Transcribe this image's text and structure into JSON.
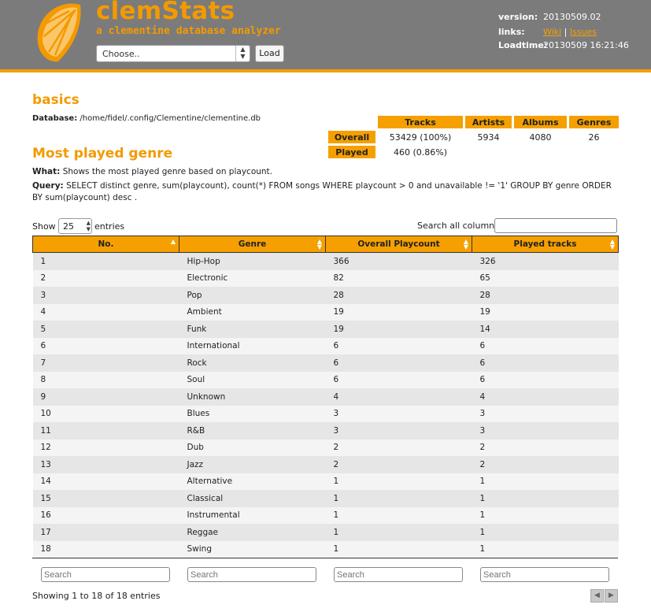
{
  "header": {
    "title": "clemStats",
    "subtitle": "a clementine database analyzer",
    "db_select_value": "Choose..",
    "load_label": "Load",
    "version_label": "version:",
    "version_value": "20130509.02",
    "links_label": "links:",
    "link_wiki": "Wiki",
    "link_sep": "|",
    "link_issues": "Issues",
    "loadtime_label": "Loadtime:",
    "loadtime_value": "20130509 16:21:46"
  },
  "basics": {
    "title": "basics",
    "database_label": "Database:",
    "database_path": "/home/fidel/.config/Clementine/clementine.db",
    "headers": [
      "Tracks",
      "Artists",
      "Albums",
      "Genres"
    ],
    "rows": [
      {
        "label": "Overall",
        "cells": [
          "53429 (100%)",
          "5934",
          "4080",
          "26"
        ]
      },
      {
        "label": "Played",
        "cells": [
          "460  (0.86%)",
          "",
          "",
          ""
        ]
      }
    ]
  },
  "genre": {
    "title": "Most played genre",
    "what_label": "What:",
    "what_text": "Shows the most played genre based on playcount.",
    "query_label": "Query:",
    "query_text": "SELECT distinct genre, sum(playcount), count(*) FROM songs WHERE playcount > 0 and unavailable != '1' GROUP BY genre ORDER BY sum(playcount) desc ."
  },
  "table_controls": {
    "show_label": "Show",
    "show_value": "25",
    "entries_label": "entries",
    "search_all_label": "Search all columns:",
    "search_placeholder": "Search"
  },
  "table": {
    "columns": [
      "No.",
      "Genre",
      "Overall Playcount",
      "Played tracks"
    ],
    "rows": [
      [
        "1",
        "Hip-Hop",
        "366",
        "326"
      ],
      [
        "2",
        "Electronic",
        "82",
        "65"
      ],
      [
        "3",
        "Pop",
        "28",
        "28"
      ],
      [
        "4",
        "Ambient",
        "19",
        "19"
      ],
      [
        "5",
        "Funk",
        "19",
        "14"
      ],
      [
        "6",
        "International",
        "6",
        "6"
      ],
      [
        "7",
        "Rock",
        "6",
        "6"
      ],
      [
        "8",
        "Soul",
        "6",
        "6"
      ],
      [
        "9",
        "Unknown",
        "4",
        "4"
      ],
      [
        "10",
        "Blues",
        "3",
        "3"
      ],
      [
        "11",
        "R&B",
        "3",
        "3"
      ],
      [
        "12",
        "Dub",
        "2",
        "2"
      ],
      [
        "13",
        "Jazz",
        "2",
        "2"
      ],
      [
        "14",
        "Alternative",
        "1",
        "1"
      ],
      [
        "15",
        "Classical",
        "1",
        "1"
      ],
      [
        "16",
        "Instrumental",
        "1",
        "1"
      ],
      [
        "17",
        "Reggae",
        "1",
        "1"
      ],
      [
        "18",
        "Swing",
        "1",
        "1"
      ]
    ]
  },
  "footer": {
    "showing_text": "Showing 1 to 18 of 18 entries"
  },
  "colors": {
    "accent": "#f5a000",
    "header_bg": "#7b7b7b"
  }
}
